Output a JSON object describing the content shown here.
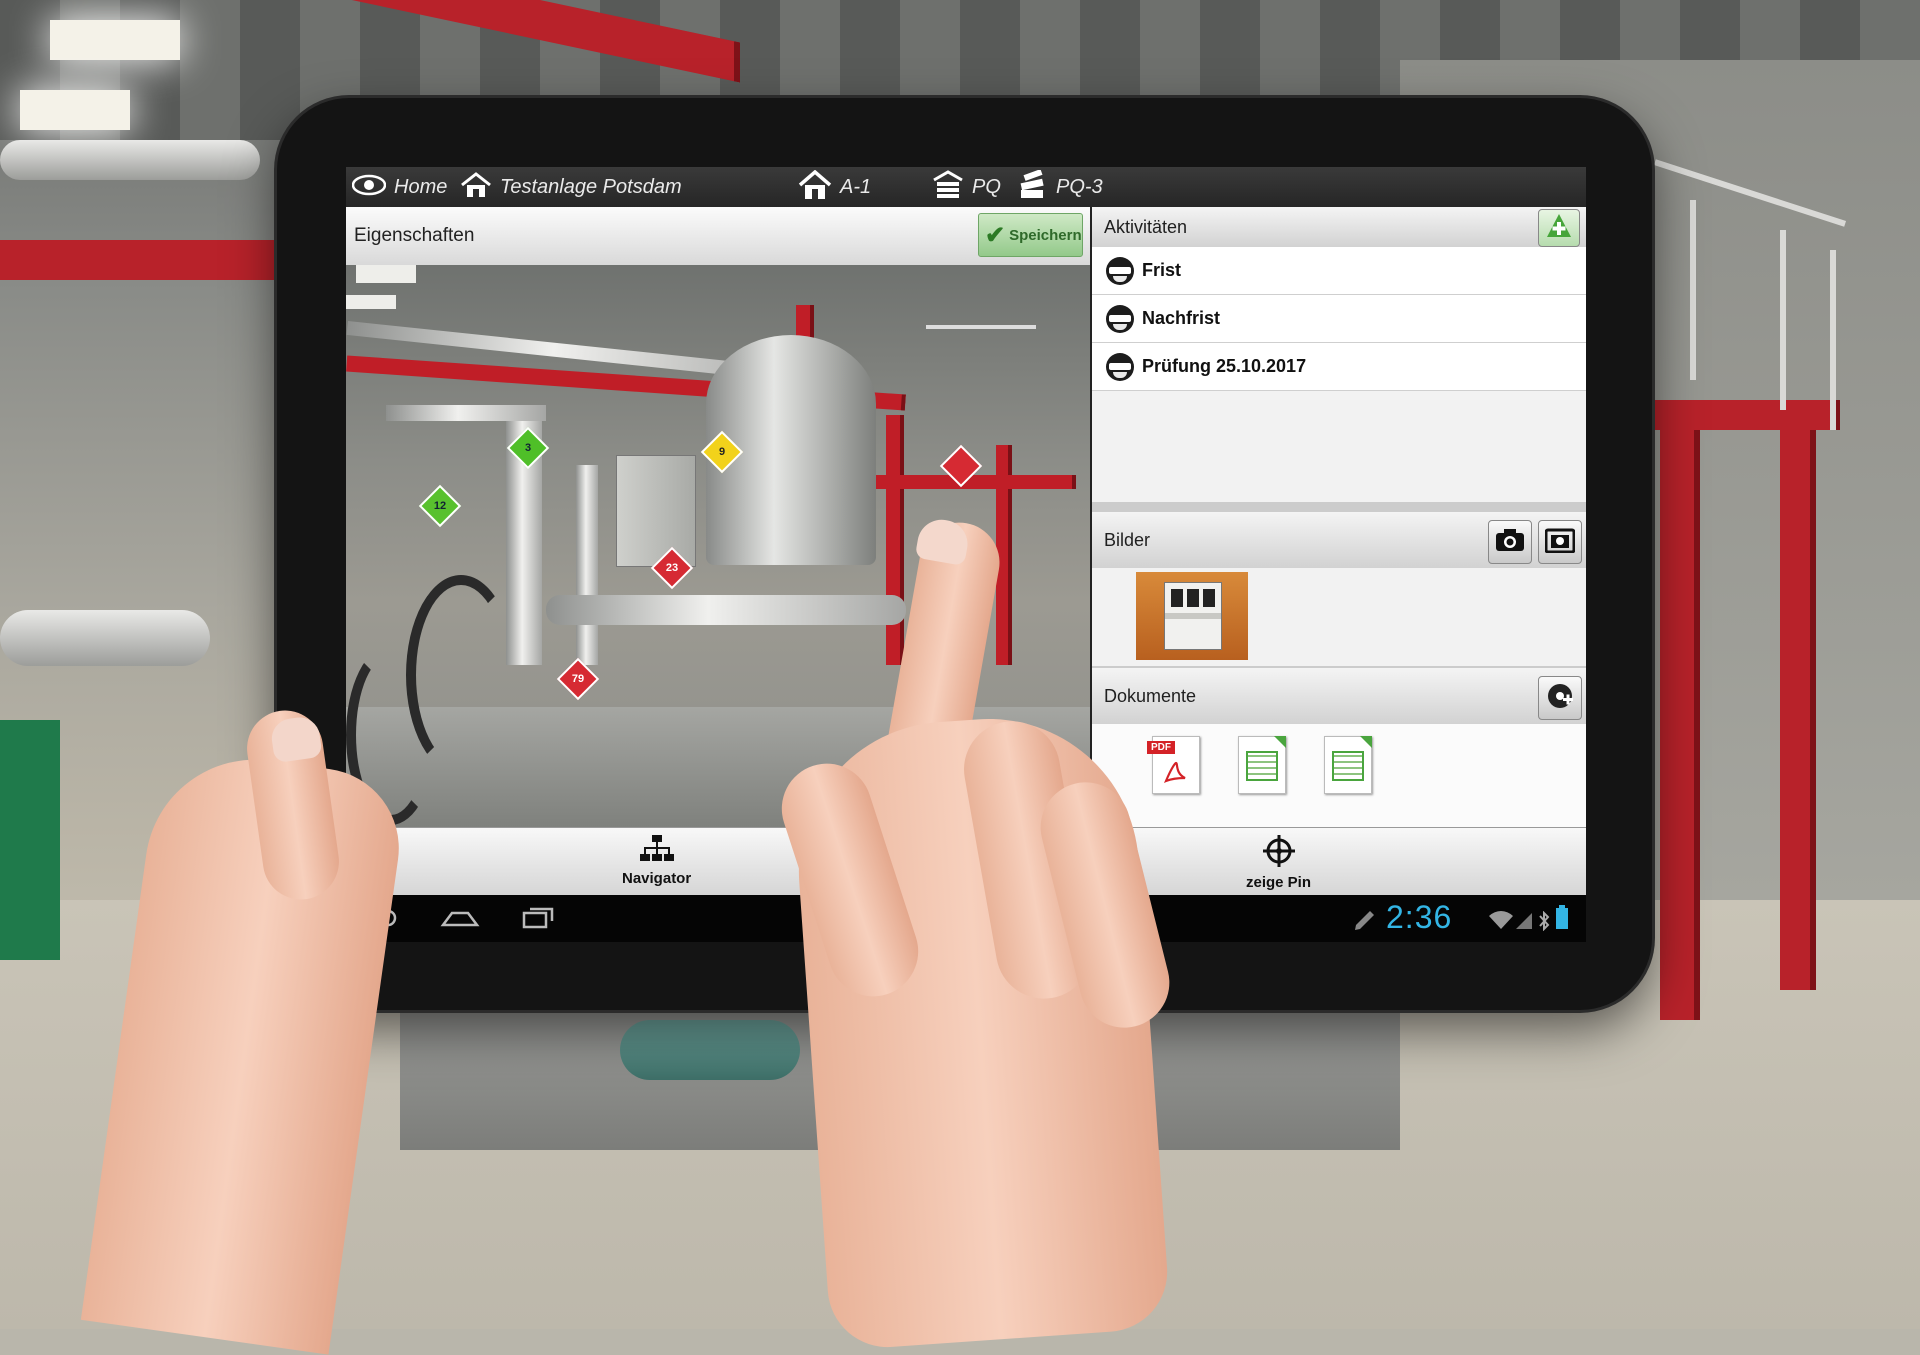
{
  "topbar": {
    "home": "Home",
    "site": "Testanlage Potsdam",
    "area": "A-1",
    "pq": "PQ",
    "pq3": "PQ-3"
  },
  "properties": {
    "title": "Eigenschaften",
    "save_label": "Speichern"
  },
  "pins": [
    {
      "label": "3",
      "color": "#4fbf28"
    },
    {
      "label": "9",
      "color": "#f2d21b"
    },
    {
      "label": "12",
      "color": "#59c12e"
    },
    {
      "label": "23",
      "color": "#d62a33"
    },
    {
      "label": "79",
      "color": "#d62a33"
    },
    {
      "label": "",
      "color": "#d62a33"
    }
  ],
  "activities": {
    "title": "Aktivitäten",
    "items": [
      "Frist",
      "Nachfrist",
      "Prüfung 25.10.2017"
    ]
  },
  "images": {
    "title": "Bilder"
  },
  "documents": {
    "title": "Dokumente",
    "items": [
      {
        "type": "pdf",
        "badge": "PDF"
      },
      {
        "type": "spreadsheet"
      },
      {
        "type": "spreadsheet"
      }
    ]
  },
  "toolbar": {
    "navigator": "Navigator",
    "show_pin": "zeige Pin"
  },
  "statusbar": {
    "time": "2:36"
  },
  "colors": {
    "accent_blue": "#33b5e5",
    "save_green": "#93c98a",
    "pin_red": "#d62a33"
  }
}
